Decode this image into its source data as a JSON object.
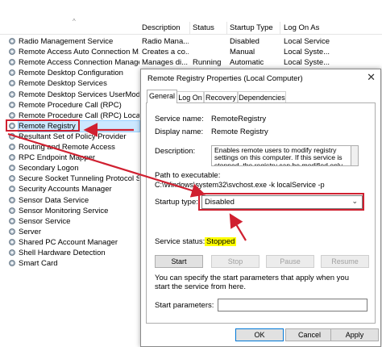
{
  "columns": {
    "description": "Description",
    "status": "Status",
    "startup_type": "Startup Type",
    "log_on_as": "Log On As"
  },
  "services": [
    {
      "name": "Radio Management Service",
      "description": "Radio Mana...",
      "status": "",
      "startup": "Disabled",
      "logon": "Local Service"
    },
    {
      "name": "Remote Access Auto Connection M...",
      "description": "Creates a co...",
      "status": "",
      "startup": "Manual",
      "logon": "Local Syste..."
    },
    {
      "name": "Remote Access Connection Manager",
      "description": "Manages di...",
      "status": "Running",
      "startup": "Automatic",
      "logon": "Local Syste..."
    },
    {
      "name": "Remote Desktop Configuration",
      "description": "",
      "status": "",
      "startup": "",
      "logon": ""
    },
    {
      "name": "Remote Desktop Services",
      "description": "",
      "status": "",
      "startup": "",
      "logon": ""
    },
    {
      "name": "Remote Desktop Services UserMode...",
      "description": "",
      "status": "",
      "startup": "",
      "logon": ""
    },
    {
      "name": "Remote Procedure Call (RPC)",
      "description": "",
      "status": "",
      "startup": "",
      "logon": ""
    },
    {
      "name": "Remote Procedure Call (RPC) Locator",
      "description": "",
      "status": "",
      "startup": "",
      "logon": ""
    },
    {
      "name": "Remote Registry",
      "description": "",
      "status": "",
      "startup": "",
      "logon": "",
      "selected": true
    },
    {
      "name": "Resultant Set of Policy Provider",
      "description": "",
      "status": "",
      "startup": "",
      "logon": ""
    },
    {
      "name": "Routing and Remote Access",
      "description": "",
      "status": "",
      "startup": "",
      "logon": ""
    },
    {
      "name": "RPC Endpoint Mapper",
      "description": "",
      "status": "",
      "startup": "",
      "logon": ""
    },
    {
      "name": "Secondary Logon",
      "description": "",
      "status": "",
      "startup": "",
      "logon": ""
    },
    {
      "name": "Secure Socket Tunneling Protocol S...",
      "description": "",
      "status": "",
      "startup": "",
      "logon": ""
    },
    {
      "name": "Security Accounts Manager",
      "description": "",
      "status": "",
      "startup": "",
      "logon": ""
    },
    {
      "name": "Sensor Data Service",
      "description": "",
      "status": "",
      "startup": "",
      "logon": ""
    },
    {
      "name": "Sensor Monitoring Service",
      "description": "",
      "status": "",
      "startup": "",
      "logon": ""
    },
    {
      "name": "Sensor Service",
      "description": "",
      "status": "",
      "startup": "",
      "logon": ""
    },
    {
      "name": "Server",
      "description": "",
      "status": "",
      "startup": "",
      "logon": ""
    },
    {
      "name": "Shared PC Account Manager",
      "description": "",
      "status": "",
      "startup": "",
      "logon": ""
    },
    {
      "name": "Shell Hardware Detection",
      "description": "",
      "status": "",
      "startup": "",
      "logon": ""
    },
    {
      "name": "Smart Card",
      "description": "",
      "status": "",
      "startup": "",
      "logon": ""
    }
  ],
  "dialog": {
    "title": "Remote Registry Properties (Local Computer)",
    "close_glyph": "✕",
    "tabs": [
      "General",
      "Log On",
      "Recovery",
      "Dependencies"
    ],
    "service_name_label": "Service name:",
    "service_name": "RemoteRegistry",
    "display_name_label": "Display name:",
    "display_name": "Remote Registry",
    "description_label": "Description:",
    "description": "Enables remote users to modify registry settings on this computer. If this service is stopped, the registry can be modified only by users on this computer. If",
    "path_label": "Path to executable:",
    "path": "C:\\Windows\\system32\\svchost.exe -k localService -p",
    "startup_type_label": "Startup type:",
    "startup_type": "Disabled",
    "service_status_label": "Service status:",
    "service_status": "Stopped",
    "buttons": {
      "start": "Start",
      "stop": "Stop",
      "pause": "Pause",
      "resume": "Resume"
    },
    "help_text": "You can specify the start parameters that apply when you start the service from here.",
    "start_params_label": "Start parameters:",
    "start_params_value": "",
    "ok": "OK",
    "cancel": "Cancel",
    "apply": "Apply"
  },
  "colors": {
    "annotation": "#d02030",
    "highlight": "#ffff00",
    "selection": "#cce8ff"
  }
}
